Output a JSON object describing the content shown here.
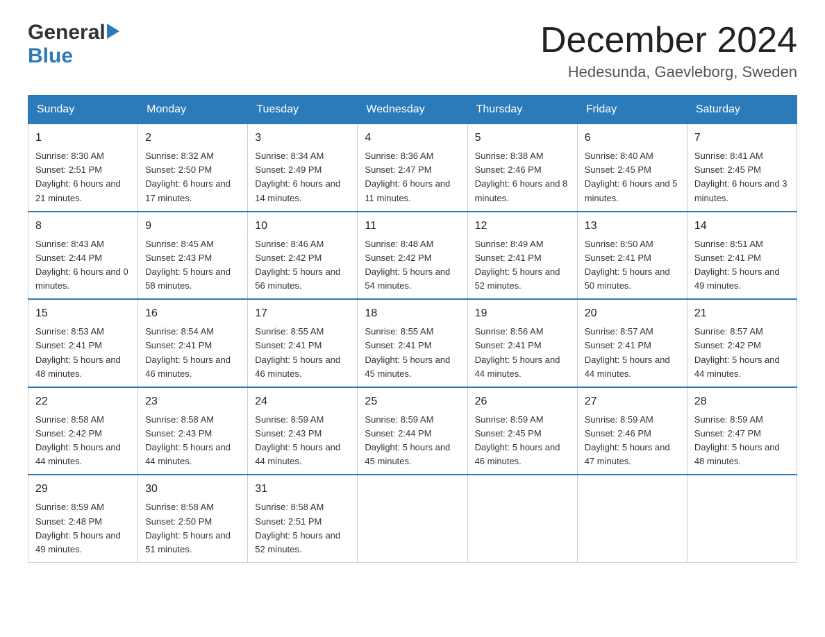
{
  "header": {
    "title": "December 2024",
    "location": "Hedesunda, Gaevleborg, Sweden",
    "logo_general": "General",
    "logo_blue": "Blue"
  },
  "calendar": {
    "days_of_week": [
      "Sunday",
      "Monday",
      "Tuesday",
      "Wednesday",
      "Thursday",
      "Friday",
      "Saturday"
    ],
    "weeks": [
      [
        {
          "day": "1",
          "sunrise": "8:30 AM",
          "sunset": "2:51 PM",
          "daylight": "6 hours and 21 minutes."
        },
        {
          "day": "2",
          "sunrise": "8:32 AM",
          "sunset": "2:50 PM",
          "daylight": "6 hours and 17 minutes."
        },
        {
          "day": "3",
          "sunrise": "8:34 AM",
          "sunset": "2:49 PM",
          "daylight": "6 hours and 14 minutes."
        },
        {
          "day": "4",
          "sunrise": "8:36 AM",
          "sunset": "2:47 PM",
          "daylight": "6 hours and 11 minutes."
        },
        {
          "day": "5",
          "sunrise": "8:38 AM",
          "sunset": "2:46 PM",
          "daylight": "6 hours and 8 minutes."
        },
        {
          "day": "6",
          "sunrise": "8:40 AM",
          "sunset": "2:45 PM",
          "daylight": "6 hours and 5 minutes."
        },
        {
          "day": "7",
          "sunrise": "8:41 AM",
          "sunset": "2:45 PM",
          "daylight": "6 hours and 3 minutes."
        }
      ],
      [
        {
          "day": "8",
          "sunrise": "8:43 AM",
          "sunset": "2:44 PM",
          "daylight": "6 hours and 0 minutes."
        },
        {
          "day": "9",
          "sunrise": "8:45 AM",
          "sunset": "2:43 PM",
          "daylight": "5 hours and 58 minutes."
        },
        {
          "day": "10",
          "sunrise": "8:46 AM",
          "sunset": "2:42 PM",
          "daylight": "5 hours and 56 minutes."
        },
        {
          "day": "11",
          "sunrise": "8:48 AM",
          "sunset": "2:42 PM",
          "daylight": "5 hours and 54 minutes."
        },
        {
          "day": "12",
          "sunrise": "8:49 AM",
          "sunset": "2:41 PM",
          "daylight": "5 hours and 52 minutes."
        },
        {
          "day": "13",
          "sunrise": "8:50 AM",
          "sunset": "2:41 PM",
          "daylight": "5 hours and 50 minutes."
        },
        {
          "day": "14",
          "sunrise": "8:51 AM",
          "sunset": "2:41 PM",
          "daylight": "5 hours and 49 minutes."
        }
      ],
      [
        {
          "day": "15",
          "sunrise": "8:53 AM",
          "sunset": "2:41 PM",
          "daylight": "5 hours and 48 minutes."
        },
        {
          "day": "16",
          "sunrise": "8:54 AM",
          "sunset": "2:41 PM",
          "daylight": "5 hours and 46 minutes."
        },
        {
          "day": "17",
          "sunrise": "8:55 AM",
          "sunset": "2:41 PM",
          "daylight": "5 hours and 46 minutes."
        },
        {
          "day": "18",
          "sunrise": "8:55 AM",
          "sunset": "2:41 PM",
          "daylight": "5 hours and 45 minutes."
        },
        {
          "day": "19",
          "sunrise": "8:56 AM",
          "sunset": "2:41 PM",
          "daylight": "5 hours and 44 minutes."
        },
        {
          "day": "20",
          "sunrise": "8:57 AM",
          "sunset": "2:41 PM",
          "daylight": "5 hours and 44 minutes."
        },
        {
          "day": "21",
          "sunrise": "8:57 AM",
          "sunset": "2:42 PM",
          "daylight": "5 hours and 44 minutes."
        }
      ],
      [
        {
          "day": "22",
          "sunrise": "8:58 AM",
          "sunset": "2:42 PM",
          "daylight": "5 hours and 44 minutes."
        },
        {
          "day": "23",
          "sunrise": "8:58 AM",
          "sunset": "2:43 PM",
          "daylight": "5 hours and 44 minutes."
        },
        {
          "day": "24",
          "sunrise": "8:59 AM",
          "sunset": "2:43 PM",
          "daylight": "5 hours and 44 minutes."
        },
        {
          "day": "25",
          "sunrise": "8:59 AM",
          "sunset": "2:44 PM",
          "daylight": "5 hours and 45 minutes."
        },
        {
          "day": "26",
          "sunrise": "8:59 AM",
          "sunset": "2:45 PM",
          "daylight": "5 hours and 46 minutes."
        },
        {
          "day": "27",
          "sunrise": "8:59 AM",
          "sunset": "2:46 PM",
          "daylight": "5 hours and 47 minutes."
        },
        {
          "day": "28",
          "sunrise": "8:59 AM",
          "sunset": "2:47 PM",
          "daylight": "5 hours and 48 minutes."
        }
      ],
      [
        {
          "day": "29",
          "sunrise": "8:59 AM",
          "sunset": "2:48 PM",
          "daylight": "5 hours and 49 minutes."
        },
        {
          "day": "30",
          "sunrise": "8:58 AM",
          "sunset": "2:50 PM",
          "daylight": "5 hours and 51 minutes."
        },
        {
          "day": "31",
          "sunrise": "8:58 AM",
          "sunset": "2:51 PM",
          "daylight": "5 hours and 52 minutes."
        },
        null,
        null,
        null,
        null
      ]
    ]
  }
}
